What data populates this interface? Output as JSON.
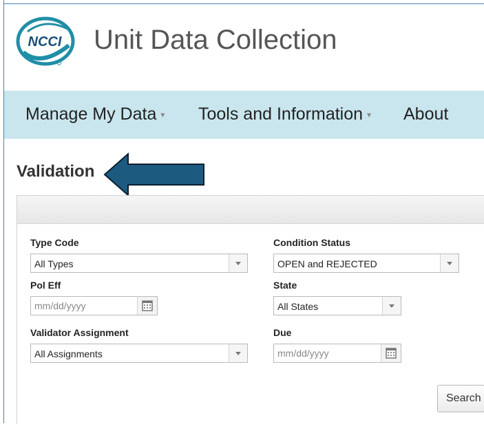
{
  "app": {
    "title": "Unit Data Collection",
    "logo_text": "NCCI"
  },
  "nav": {
    "items": [
      {
        "label": "Manage My Data",
        "has_caret": true
      },
      {
        "label": "Tools and Information",
        "has_caret": true
      },
      {
        "label": "About",
        "has_caret": false
      }
    ],
    "caret": "▾"
  },
  "page": {
    "title": "Validation"
  },
  "filters": {
    "type_code": {
      "label": "Type Code",
      "value": "All Types"
    },
    "condition_status": {
      "label": "Condition Status",
      "value": "OPEN and REJECTED"
    },
    "pol_eff": {
      "label": "Pol Eff",
      "placeholder": "mm/dd/yyyy"
    },
    "state": {
      "label": "State",
      "value": "All States"
    },
    "validator_assignment": {
      "label": "Validator Assignment",
      "value": "All Assignments"
    },
    "due": {
      "label": "Due",
      "placeholder": "mm/dd/yyyy"
    }
  },
  "actions": {
    "search_label": "Search"
  },
  "colors": {
    "nav_bg": "#c9e6ee",
    "brand_teal": "#1f8ea6",
    "arrow_fill": "#1c5a80",
    "frame_border": "#4a7fb5"
  }
}
